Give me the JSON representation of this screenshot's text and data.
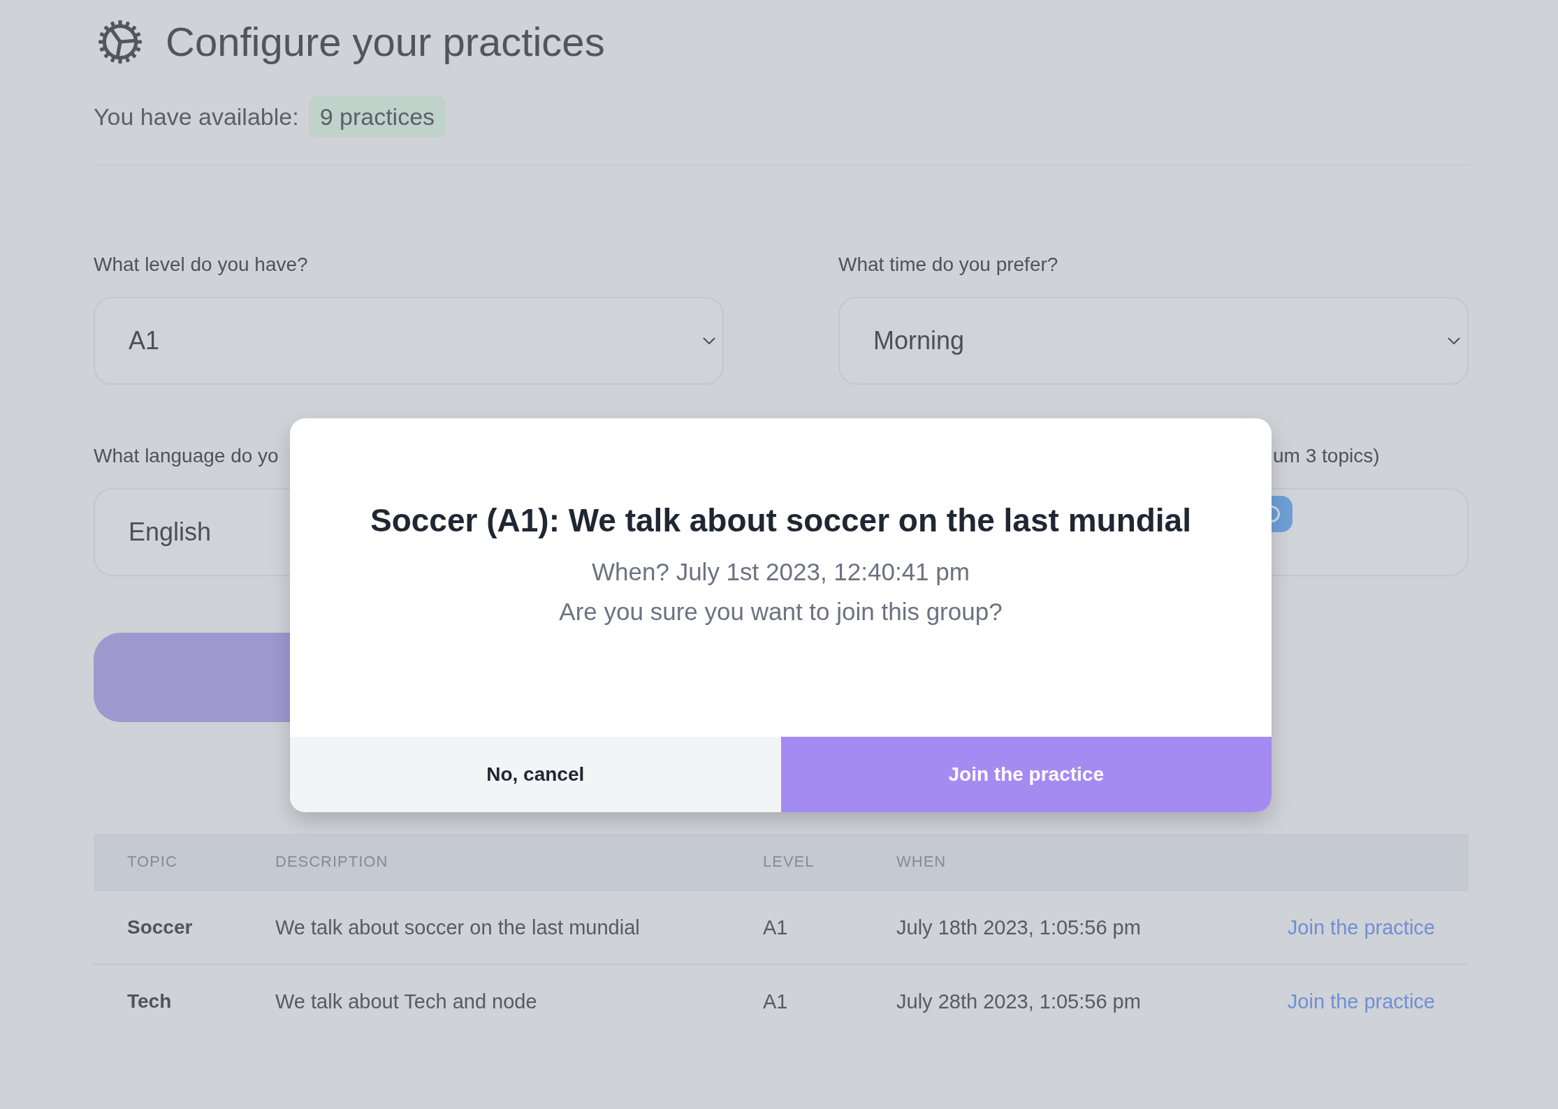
{
  "header": {
    "title": "Configure your practices",
    "available_label": "You have available:",
    "available_count": "9 practices"
  },
  "form": {
    "fields": [
      {
        "kind": "select",
        "label": "What level do you have?",
        "value": "A1"
      },
      {
        "kind": "select",
        "label": "What time do you prefer?",
        "value": "Morning"
      },
      {
        "kind": "select",
        "label": "What language do yo",
        "value": "English"
      },
      {
        "kind": "tags",
        "label": "um 3 topics)"
      }
    ]
  },
  "table": {
    "columns": [
      "TOPIC",
      "DESCRIPTION",
      "LEVEL",
      "WHEN"
    ],
    "rows": [
      {
        "topic": "Soccer",
        "description": "We talk about soccer on the last mundial",
        "level": "A1",
        "when": "July 18th 2023, 1:05:56 pm",
        "action": "Join the practice"
      },
      {
        "topic": "Tech",
        "description": "We talk about Tech and node",
        "level": "A1",
        "when": "July 28th 2023, 1:05:56 pm",
        "action": "Join the practice"
      }
    ]
  },
  "dialog": {
    "title": "Soccer (A1): We talk about soccer on the last mundial",
    "lines": [
      "When? July 1st 2023, 12:40:41 pm",
      "Are you sure you want to join this group?"
    ],
    "buttons": [
      {
        "kind": "secondary",
        "label": "No, cancel"
      },
      {
        "kind": "primary",
        "label": "Join the practice"
      }
    ]
  }
}
